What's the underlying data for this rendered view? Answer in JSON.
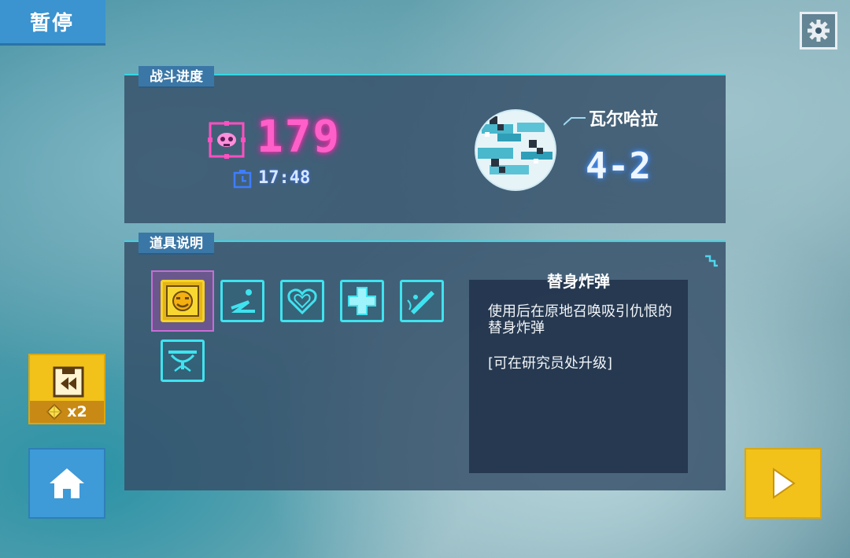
{
  "header": {
    "pause_label": "暂停",
    "settings_icon": "gear-icon"
  },
  "progress": {
    "section_label": "战斗进度",
    "kill_count": "179",
    "kill_icon": "skull-target-icon",
    "time": "17:48",
    "timer_icon": "stopwatch-icon",
    "planet_name": "瓦尔哈拉",
    "stage": "4-2"
  },
  "items": {
    "section_label": "道具说明",
    "slots": [
      {
        "icon": "angry-sun-bomb-icon",
        "selected": true
      },
      {
        "icon": "squiggle-path-icon",
        "selected": false
      },
      {
        "icon": "heart-icon",
        "selected": false
      },
      {
        "icon": "medical-cross-icon",
        "selected": false
      },
      {
        "icon": "rocket-launcher-icon",
        "selected": false
      },
      {
        "icon": "eye-laser-icon",
        "selected": false
      }
    ],
    "detail": {
      "title": "替身炸弹",
      "description": "使用后在原地召唤吸引仇恨的替身炸弹",
      "upgrade_note": "[可在研究员处升级]"
    }
  },
  "buttons": {
    "rewind_cost": "x2",
    "rewind_icon": "rewind-icon",
    "gem_icon": "gem-icon",
    "home_icon": "home-icon",
    "play_icon": "play-icon"
  },
  "colors": {
    "accent_cyan": "#33d7e6",
    "kill_pink": "#ff5fc8",
    "button_yellow": "#f2c21a",
    "button_blue": "#3f9ad8"
  }
}
